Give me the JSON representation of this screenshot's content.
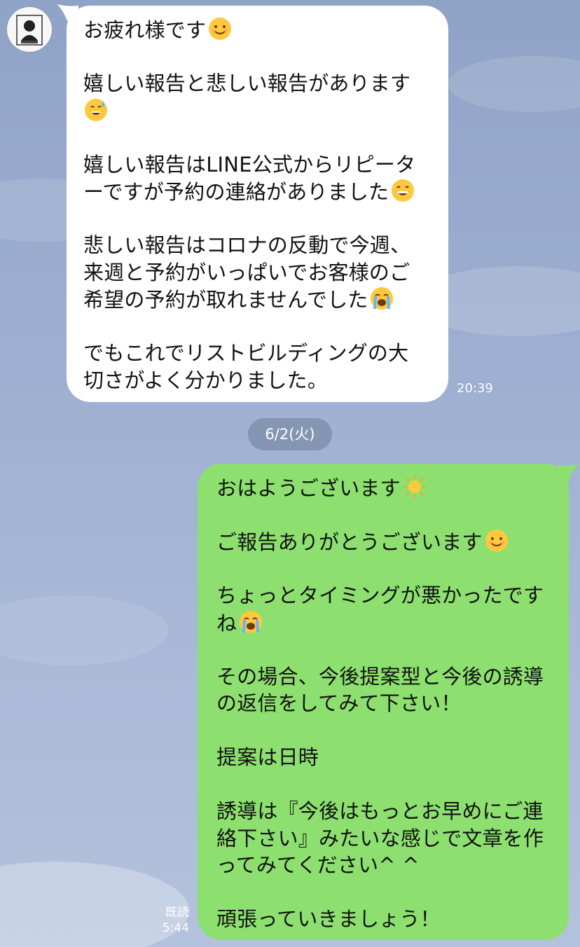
{
  "date_divider": "6/2(火)",
  "incoming": {
    "time": "20:39",
    "lines": {
      "l1": "お疲れ様です",
      "l2": "嬉しい報告と悲しい報告があります",
      "l3": "嬉しい報告はLINE公式からリピータ",
      "l4": "ーですが予約の連絡がありました",
      "l5": "悲しい報告はコロナの反動で今週、",
      "l6": "来週と予約がいっぱいでお客様のご",
      "l7": "希望の予約が取れませんでした",
      "l8": "でもこれでリストビルディングの大",
      "l9": "切さがよく分かりました。"
    }
  },
  "outgoing": {
    "read_label": "既読",
    "time": "5:44",
    "lines": {
      "l1": "おはようございます",
      "l2": "ご報告ありがとうございます",
      "l3": "ちょっとタイミングが悪かったです",
      "l4": "ね",
      "l5": "その場合、今後提案型と今後の誘導",
      "l6": "の返信をしてみて下さい！",
      "l7": "提案は日時",
      "l8": "誘導は『今後はもっとお早めにご連",
      "l9": "絡下さい』みたいな感じで文章を作",
      "l10": "ってみてください^ ^",
      "l11": "頑張っていきましょう！"
    }
  },
  "colors": {
    "background": "#9aadcf",
    "incoming_bubble": "#ffffff",
    "outgoing_bubble": "#8de070"
  },
  "icons": {
    "avatar": "avatar-icon",
    "smile": "smiling-face-icon",
    "sweat": "grinning-sweat-icon",
    "grin": "grinning-face-icon",
    "cry": "loudly-crying-face-icon",
    "sun": "sun-icon"
  }
}
